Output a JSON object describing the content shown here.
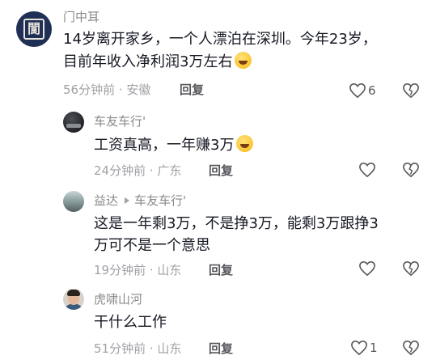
{
  "comments": [
    {
      "username": "门中耳",
      "text_line1": "14岁离开家乡，一个人漂泊在深圳。今年23岁，",
      "text_line2": "目前年收入净利润3万左右",
      "emoji": "grinning-squint-emoji",
      "time_location": "56分钟前 · 安徽",
      "reply_label": "回复",
      "like_count": "6"
    },
    {
      "username": "车友车行'",
      "text_line1": "工资真高，一年赚3万",
      "emoji": "laughing-tears-emoji",
      "time_location": "24分钟前 · 广东",
      "reply_label": "回复"
    },
    {
      "username": "益达",
      "reply_to": "车友车行'",
      "text_line1": "这是一年剩3万，不是挣3万，能剩3万跟挣3",
      "text_line2": "万可不是一个意思",
      "time_location": "19分钟前 · 山东",
      "reply_label": "回复"
    },
    {
      "username": "虎啸山河",
      "text_line1": "干什么工作",
      "time_location": "51分钟前 · 山东",
      "reply_label": "回复",
      "like_count": "1"
    }
  ],
  "icons": {
    "like": "heart-outline-icon",
    "dislike": "broken-heart-outline-icon",
    "reply_arrow": "triangle-right-icon"
  }
}
